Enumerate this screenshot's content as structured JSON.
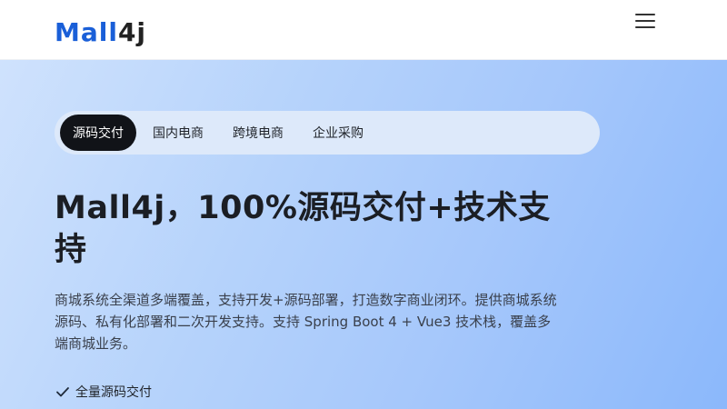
{
  "header": {
    "logo_prefix": "Mall",
    "logo_suffix": "4j",
    "menu_icon": "hamburger-menu-icon"
  },
  "tabs": [
    {
      "label": "源码交付",
      "active": true
    },
    {
      "label": "国内电商",
      "active": false
    },
    {
      "label": "跨境电商",
      "active": false
    },
    {
      "label": "企业采购",
      "active": false
    }
  ],
  "hero": {
    "headline": "Mall4j，100%源码交付+技术支持",
    "description": "商城系统全渠道多端覆盖，支持开发+源码部署，打造数字商业闭环。提供商城系统源码、私有化部署和二次开发支持。支持 Spring Boot 4 + Vue3 技术栈，覆盖多端商城业务。",
    "features": [
      {
        "label": "全量源码交付",
        "icon": "check-icon"
      }
    ]
  },
  "colors": {
    "brand_blue": "#1a5fd8",
    "active_tab_bg": "#111318",
    "tabs_bar_bg": "#dde9fa",
    "hero_gradient_start": "#cfe2fd",
    "hero_gradient_end": "#8bb8fb"
  }
}
